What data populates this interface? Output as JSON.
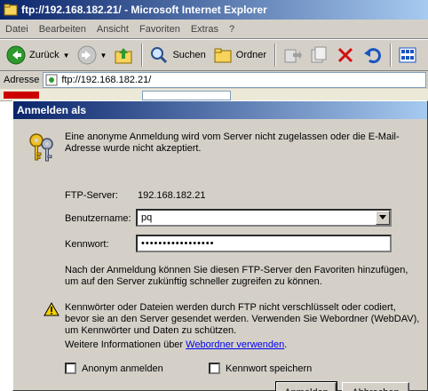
{
  "window": {
    "title": "ftp://192.168.182.21/ - Microsoft Internet Explorer"
  },
  "menu": {
    "items": [
      "Datei",
      "Bearbeiten",
      "Ansicht",
      "Favoriten",
      "Extras",
      "?"
    ]
  },
  "toolbar": {
    "back_label": "Zurück",
    "search_label": "Suchen",
    "folders_label": "Ordner"
  },
  "address": {
    "label": "Adresse",
    "value": "ftp://192.168.182.21/"
  },
  "dialog": {
    "title": "Anmelden als",
    "message": "Eine anonyme Anmeldung wird vom Server nicht zugelassen oder die E-Mail-Adresse wurde nicht akzeptiert.",
    "server_label": "FTP-Server:",
    "server_value": "192.168.182.21",
    "username_label": "Benutzername:",
    "username_value": "pq",
    "password_label": "Kennwort:",
    "password_value": "•••••••••••••••••",
    "info_text": "Nach der Anmeldung können Sie diesen FTP-Server den Favoriten hinzufügen, um auf den Server zukünftig schneller zugreifen zu können.",
    "warning_text": "Kennwörter oder Dateien werden durch FTP nicht verschlüsselt oder codiert, bevor sie an den Server gesendet werden. Verwenden Sie Webordner (WebDAV), um Kennwörter und Daten zu schützen.",
    "more_info_text": "Weitere Informationen über ",
    "more_info_link": "Webordner verwenden",
    "more_info_end": ".",
    "anonymous_label": "Anonym anmelden",
    "save_password_label": "Kennwort speichern",
    "login_button": "Anmelden",
    "cancel_button": "Abbrechen"
  }
}
